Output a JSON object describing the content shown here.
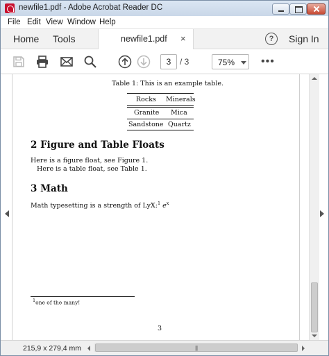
{
  "window": {
    "title": "newfile1.pdf - Adobe Acrobat Reader DC"
  },
  "menu": {
    "items": [
      "File",
      "Edit",
      "View",
      "Window",
      "Help"
    ]
  },
  "tabs": {
    "home": "Home",
    "tools": "Tools",
    "document": "newfile1.pdf",
    "close_glyph": "×",
    "help_glyph": "?",
    "sign_in": "Sign In"
  },
  "toolbar": {
    "icons": [
      "save-icon",
      "print-icon",
      "email-icon",
      "search-icon",
      "page-up-icon",
      "page-down-icon",
      "more-icon"
    ],
    "current_page": "3",
    "page_total": "/ 3",
    "zoom": "75%",
    "more_glyph": "•••"
  },
  "document": {
    "table_caption": "Table 1: This is an example table.",
    "table": {
      "headers": [
        "Rocks",
        "Minerals"
      ],
      "rows": [
        [
          "Granite",
          "Mica"
        ],
        [
          "Sandstone",
          "Quartz"
        ]
      ]
    },
    "section2_title": "2  Figure and Table Floats",
    "section2_line1": "Here is a figure float, see Figure 1.",
    "section2_line2": "Here is a table float, see Table 1.",
    "section3_title": "3  Math",
    "section3_text": "Math typesetting is a strength of LyX:",
    "section3_sup": "1",
    "section3_math": "e",
    "section3_math_sup": "x",
    "footnote_mark": "1",
    "footnote_text": "one of the many!",
    "page_number": "3"
  },
  "status": {
    "page_size": "215,9 x 279,4 mm",
    "scroll_grip": "|||"
  }
}
